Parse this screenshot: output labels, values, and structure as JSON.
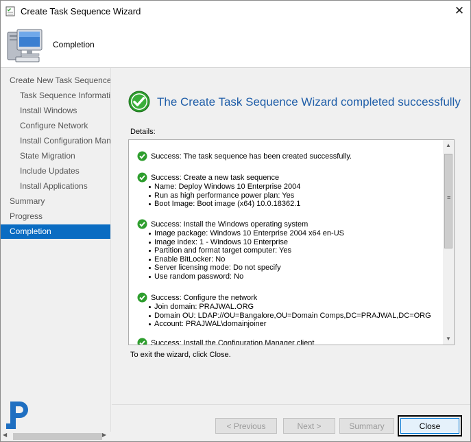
{
  "window": {
    "title": "Create Task Sequence Wizard",
    "close_glyph": "✕"
  },
  "header": {
    "title": "Completion"
  },
  "sidebar": {
    "items": [
      {
        "label": "Create New Task Sequence",
        "level": "top"
      },
      {
        "label": "Task Sequence Information",
        "level": "sub"
      },
      {
        "label": "Install Windows",
        "level": "sub"
      },
      {
        "label": "Configure Network",
        "level": "sub"
      },
      {
        "label": "Install Configuration Manager",
        "level": "sub"
      },
      {
        "label": "State Migration",
        "level": "sub"
      },
      {
        "label": "Include Updates",
        "level": "sub"
      },
      {
        "label": "Install Applications",
        "level": "sub"
      },
      {
        "label": "Summary",
        "level": "top"
      },
      {
        "label": "Progress",
        "level": "top"
      },
      {
        "label": "Completion",
        "level": "top",
        "selected": true
      }
    ]
  },
  "main": {
    "heading": "The Create Task Sequence Wizard completed successfully",
    "details_label": "Details:",
    "details": [
      {
        "head": "Success: The task sequence has been created successfully.",
        "items": []
      },
      {
        "head": "Success: Create a new task sequence",
        "items": [
          "Name: Deploy Windows 10 Enterprise 2004",
          "Run as high performance power plan: Yes",
          "Boot Image: Boot image (x64) 10.0.18362.1"
        ]
      },
      {
        "head": "Success: Install the Windows operating system",
        "items": [
          "Image package: Windows 10 Enterprise 2004 x64 en-US",
          "Image index: 1 - Windows 10 Enterprise",
          "Partition and format target computer: Yes",
          "Enable BitLocker: No",
          "Server licensing mode: Do not specify",
          "Use random password: No"
        ]
      },
      {
        "head": "Success: Configure the network",
        "items": [
          "Join domain: PRAJWAL.ORG",
          "Domain OU: LDAP://OU=Bangalore,OU=Domain Comps,DC=PRAJWAL,DC=ORG",
          "Account: PRAJWAL\\domainjoiner"
        ]
      },
      {
        "head": "Success: Install the Configuration Manager client",
        "items": []
      }
    ],
    "exit_text": "To exit the wizard, click Close."
  },
  "footer": {
    "previous_label": "< Previous",
    "next_label": "Next >",
    "summary_label": "Summary",
    "close_label": "Close"
  },
  "colors": {
    "accent": "#0a6cc2",
    "heading": "#1e5da8",
    "success": "#2e9e2e"
  },
  "icons": {
    "title": "wizard-icon",
    "header": "computer-icon",
    "status": "success-check-icon",
    "logo": "brand-logo-icon"
  }
}
